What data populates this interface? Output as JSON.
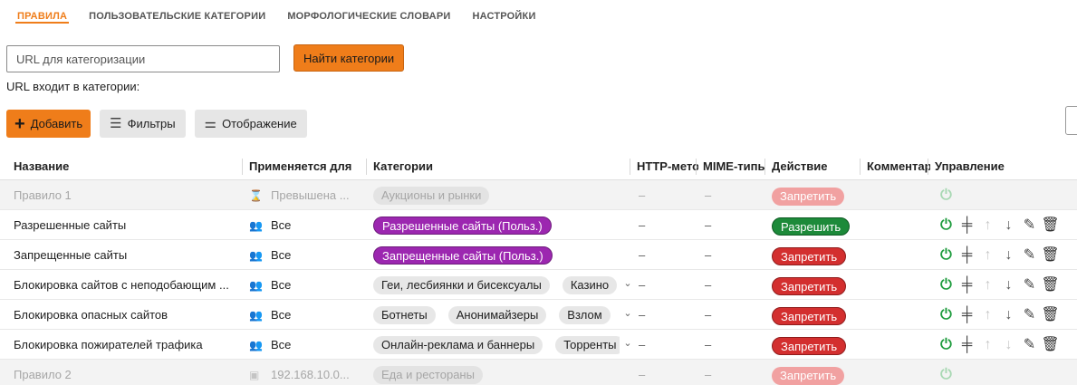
{
  "tabs": [
    {
      "label": "ПРАВИЛА",
      "active": true
    },
    {
      "label": "ПОЛЬЗОВАТЕЛЬСКИЕ КАТЕГОРИИ",
      "active": false
    },
    {
      "label": "МОРФОЛОГИЧЕСКИЕ СЛОВАРИ",
      "active": false
    },
    {
      "label": "НАСТРОЙКИ",
      "active": false
    }
  ],
  "url_search": {
    "placeholder": "URL для категоризации",
    "value": "",
    "button": "Найти категории",
    "result_label": "URL входит в категории:"
  },
  "toolbar": {
    "add": "Добавить",
    "filters": "Фильтры",
    "display": "Отображение"
  },
  "table": {
    "columns": [
      "Название",
      "Применяется для",
      "Категории",
      "HTTP-метод",
      "MIME-типы",
      "Действие",
      "Комментарий",
      "Управление"
    ],
    "rows": [
      {
        "name": "Правило 1",
        "applies": "Превышена ...",
        "applies_icon": "quota-icon",
        "categories": [
          {
            "label": "Аукционы и рынки",
            "style": "grey"
          }
        ],
        "more": false,
        "http": "–",
        "mime": "–",
        "action": "Запретить",
        "action_style": "red",
        "disabled": true,
        "controls": "power-only"
      },
      {
        "name": "Разрешенные сайты",
        "applies": "Все",
        "applies_icon": "users-icon",
        "categories": [
          {
            "label": "Разрешенные сайты (Польз.)",
            "style": "purple"
          }
        ],
        "more": false,
        "http": "–",
        "mime": "–",
        "action": "Разрешить",
        "action_style": "green",
        "disabled": false,
        "controls": "full"
      },
      {
        "name": "Запрещенные сайты",
        "applies": "Все",
        "applies_icon": "users-icon",
        "categories": [
          {
            "label": "Запрещенные сайты (Польз.)",
            "style": "purple"
          }
        ],
        "more": false,
        "http": "–",
        "mime": "–",
        "action": "Запретить",
        "action_style": "red",
        "disabled": false,
        "controls": "full"
      },
      {
        "name": "Блокировка сайтов с неподобающим ...",
        "applies": "Все",
        "applies_icon": "users-icon",
        "categories": [
          {
            "label": "Геи, лесбиянки и бисексуалы",
            "style": "grey"
          },
          {
            "label": "Казино",
            "style": "grey"
          }
        ],
        "more": true,
        "http": "–",
        "mime": "–",
        "action": "Запретить",
        "action_style": "red",
        "disabled": false,
        "controls": "full"
      },
      {
        "name": "Блокировка опасных сайтов",
        "applies": "Все",
        "applies_icon": "users-icon",
        "categories": [
          {
            "label": "Ботнеты",
            "style": "grey"
          },
          {
            "label": "Анонимайзеры",
            "style": "grey"
          },
          {
            "label": "Взлом",
            "style": "grey"
          }
        ],
        "more": true,
        "http": "–",
        "mime": "–",
        "action": "Запретить",
        "action_style": "red",
        "disabled": false,
        "controls": "full"
      },
      {
        "name": "Блокировка пожирателей трафика",
        "applies": "Все",
        "applies_icon": "users-icon",
        "categories": [
          {
            "label": "Онлайн-реклама и баннеры",
            "style": "grey"
          },
          {
            "label": "Торренты",
            "style": "grey"
          }
        ],
        "more": true,
        "http": "–",
        "mime": "–",
        "action": "Запретить",
        "action_style": "red",
        "disabled": false,
        "controls": "full-up-disabled"
      },
      {
        "name": "Правило 2",
        "applies": "192.168.10.0...",
        "applies_icon": "ip-icon",
        "categories": [
          {
            "label": "Еда и рестораны",
            "style": "grey"
          }
        ],
        "more": false,
        "http": "–",
        "mime": "–",
        "action": "Запретить",
        "action_style": "red",
        "disabled": true,
        "controls": "power-only"
      }
    ]
  },
  "colors": {
    "accent": "#ef7d1a",
    "allow": "#1d8a3a",
    "deny": "#d32f2f",
    "user_category": "#9c27b0",
    "power": "#1e9c3e"
  }
}
